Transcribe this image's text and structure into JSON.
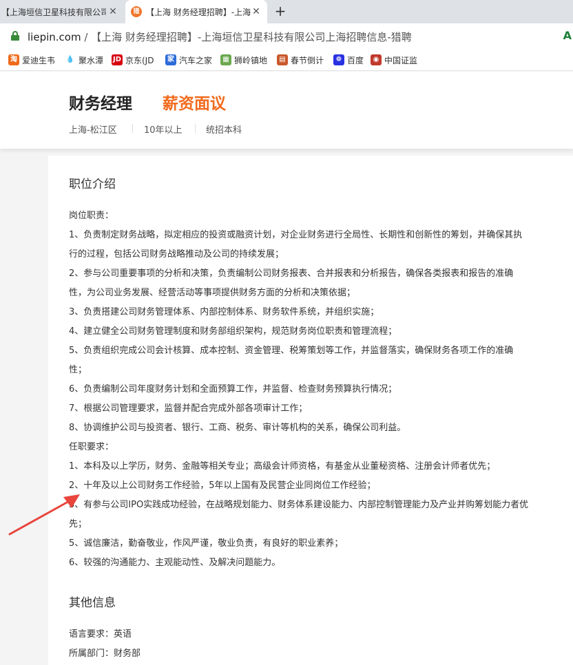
{
  "browser": {
    "tabs": [
      {
        "title": "【上海垣信卫星科技有限公司",
        "active": false
      },
      {
        "title": "【上海 财务经理招聘】-上海",
        "active": true
      }
    ],
    "url_domain": "liepin.com",
    "url_path": " / 【上海 财务经理招聘】-上海垣信卫星科技有限公司上海招聘信息-猎聘",
    "translate_icon": "A",
    "bookmarks": [
      {
        "label": "爱迪生韦",
        "icon": "taobao-icon",
        "glyph": "淘",
        "color": "#f06a1a"
      },
      {
        "label": "聚水潭",
        "icon": "water-drop-icon",
        "glyph": "💧",
        "color": "#ffffff"
      },
      {
        "label": "京东(JD",
        "icon": "jd-icon",
        "glyph": "JD",
        "color": "#d6000f"
      },
      {
        "label": "汽车之家",
        "icon": "autohome-icon",
        "glyph": "家",
        "color": "#2c6bd8"
      },
      {
        "label": "狮岭镇地",
        "icon": "map-icon",
        "glyph": "▦",
        "color": "#6aa84f"
      },
      {
        "label": "春节倒计",
        "icon": "calendar-icon",
        "glyph": "▤",
        "color": "#c9582b"
      },
      {
        "label": "百度",
        "icon": "baidu-icon",
        "glyph": "❁",
        "color": "#2932e1"
      },
      {
        "label": "中国证监",
        "icon": "csrc-icon",
        "glyph": "◉",
        "color": "#c0392b"
      }
    ]
  },
  "job": {
    "title": "财务经理",
    "salary": "薪资面议",
    "location": "上海-松江区",
    "experience": "10年以上",
    "education": "统招本科"
  },
  "description": {
    "heading": "职位介绍",
    "lines": [
      "岗位职责：",
      "1、负责制定财务战略，拟定相应的投资或融资计划，对企业财务进行全局性、长期性和创新性的筹划，并确保其执",
      "行的过程，包括公司财务战略推动及公司的持续发展；",
      "2、参与公司重要事项的分析和决策，负责编制公司财务报表、合并报表和分析报告，确保各类报表和报告的准确",
      "性，为公司业务发展、经营活动等事项提供财务方面的分析和决策依据；",
      "3、负责搭建公司财务管理体系、内部控制体系、财务软件系统，并组织实施；",
      "4、建立健全公司财务管理制度和财务部组织架构，规范财务岗位职责和管理流程；",
      "5、负责组织完成公司会计核算、成本控制、资金管理、税筹策划等工作，并监督落实，确保财务各项工作的准确",
      "性；",
      "6、负责编制公司年度财务计划和全面预算工作，并监督、检查财务预算执行情况；",
      "7、根据公司管理要求，监督并配合完成外部各项审计工作；",
      "8、协调维护公司与投资者、银行、工商、税务、审计等机构的关系，确保公司利益。",
      "任职要求：",
      "1、本科及以上学历，财务、金融等相关专业；高级会计师资格，有基金从业董秘资格、注册会计师者优先；",
      "2、十年及以上公司财务工作经验，5年以上国有及民营企业同岗位工作经验；",
      "3、有参与公司IPO实践成功经验，在战略规划能力、财务体系建设能力、内部控制管理能力及产业并购筹划能力者优",
      "先；",
      "5、诚信廉洁，勤奋敬业，作风严谨，敬业负责，有良好的职业素养；",
      "6、较强的沟通能力、主观能动性、及解决问题能力。"
    ]
  },
  "other_info": {
    "heading": "其他信息",
    "lines": [
      "语言要求：英语",
      "所属部门：财务部"
    ]
  },
  "annotation": {
    "arrow_color": "#e8453c"
  }
}
